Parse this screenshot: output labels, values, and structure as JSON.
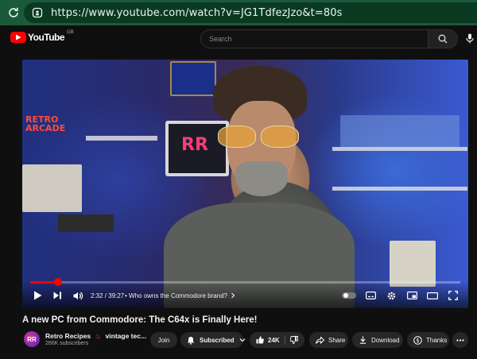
{
  "browser": {
    "url": "https://www.youtube.com/watch?v=JG1TdfezJzo&t=80s"
  },
  "masthead": {
    "logo_text": "YouTube",
    "country_code": "GB",
    "search_placeholder": "Search"
  },
  "scene": {
    "neon_text": "RETRO ARCADE",
    "monitor_text": "RR"
  },
  "player": {
    "current_time": "2:32",
    "duration": "39:27",
    "time_display": "2:32 / 39:27",
    "chapter": "• Who owns the Commodore brand?",
    "progress_fraction": 0.064,
    "accent_color": "#ff0000"
  },
  "video": {
    "title": "A new PC from Commodore: The C64x is Finally Here!",
    "channel_name": "Retro Recipes",
    "channel_extra": "vintage tec...",
    "subscriber_count": "266K subscribers",
    "avatar_initials": "RR"
  },
  "actions": {
    "join_label": "Join",
    "subscribed_label": "Subscribed",
    "like_count": "24K",
    "share_label": "Share",
    "download_label": "Download",
    "thanks_label": "Thanks"
  },
  "icons": {
    "reload": "reload-icon",
    "site_info": "site-info-icon",
    "search": "search-icon",
    "mic": "mic-icon",
    "play": "play-icon",
    "next": "next-icon",
    "volume": "volume-icon",
    "settings": "gear-icon",
    "fullscreen": "fullscreen-icon"
  }
}
